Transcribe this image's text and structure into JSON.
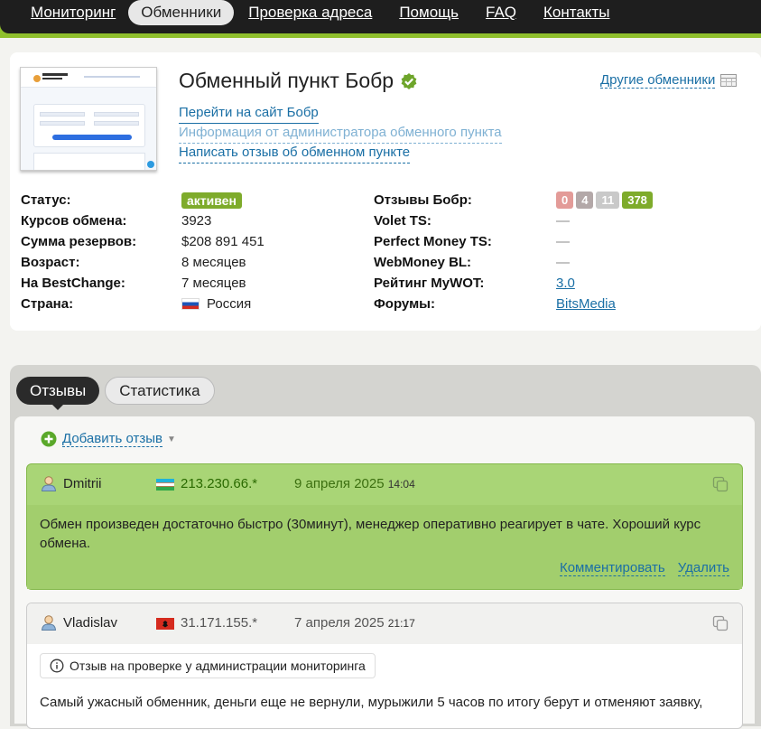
{
  "nav": {
    "items": [
      "Мониторинг",
      "Обменники",
      "Проверка адреса",
      "Помощь",
      "FAQ",
      "Контакты"
    ],
    "active_index": 1
  },
  "exchanger": {
    "title": "Обменный пункт Бобр",
    "link_site": "Перейти на сайт Бобр",
    "link_admin_info": "Информация от администратора обменного пункта",
    "link_write_review": "Написать отзыв об обменном пункте",
    "other_exchangers": "Другие обменники"
  },
  "info_left": [
    {
      "label": "Статус:",
      "value": "активен"
    },
    {
      "label": "Курсов обмена:",
      "value": "3923"
    },
    {
      "label": "Сумма резервов:",
      "value": "$208 891 451"
    },
    {
      "label": "Возраст:",
      "value": "8 месяцев"
    },
    {
      "label": "На BestChange:",
      "value": "7 месяцев"
    },
    {
      "label": "Страна:",
      "value": "Россия"
    }
  ],
  "info_right": [
    {
      "label": "Отзывы Бобр:",
      "value": ""
    },
    {
      "label": "Volet TS:",
      "value": "—"
    },
    {
      "label": "Perfect Money TS:",
      "value": "—"
    },
    {
      "label": "WebMoney BL:",
      "value": "—"
    },
    {
      "label": "Рейтинг MyWOT:",
      "value": "3.0"
    },
    {
      "label": "Форумы:",
      "value": "BitsMedia"
    }
  ],
  "review_counts": [
    "0",
    "4",
    "11",
    "378"
  ],
  "tabs": [
    "Отзывы",
    "Статистика"
  ],
  "add_review": "Добавить отзыв",
  "reviews": [
    {
      "user": "Dmitrii",
      "ip": "213.230.66.*",
      "date": "9 апреля 2025",
      "time": "14:04",
      "text": "Обмен произведен достаточно быстро (30минут), менеджер оперативно реагирует в чате. Хороший курс обмена.",
      "comment": "Комментировать",
      "delete": "Удалить"
    },
    {
      "user": "Vladislav",
      "ip": "31.171.155.*",
      "date": "7 апреля 2025",
      "time": "21:17",
      "notice": "Отзыв на проверке у администрации мониторинга",
      "text": "Самый ужасный обменник, деньги еще не вернули, мурыжили 5 часов по итогу берут и отменяют заявку,"
    }
  ]
}
